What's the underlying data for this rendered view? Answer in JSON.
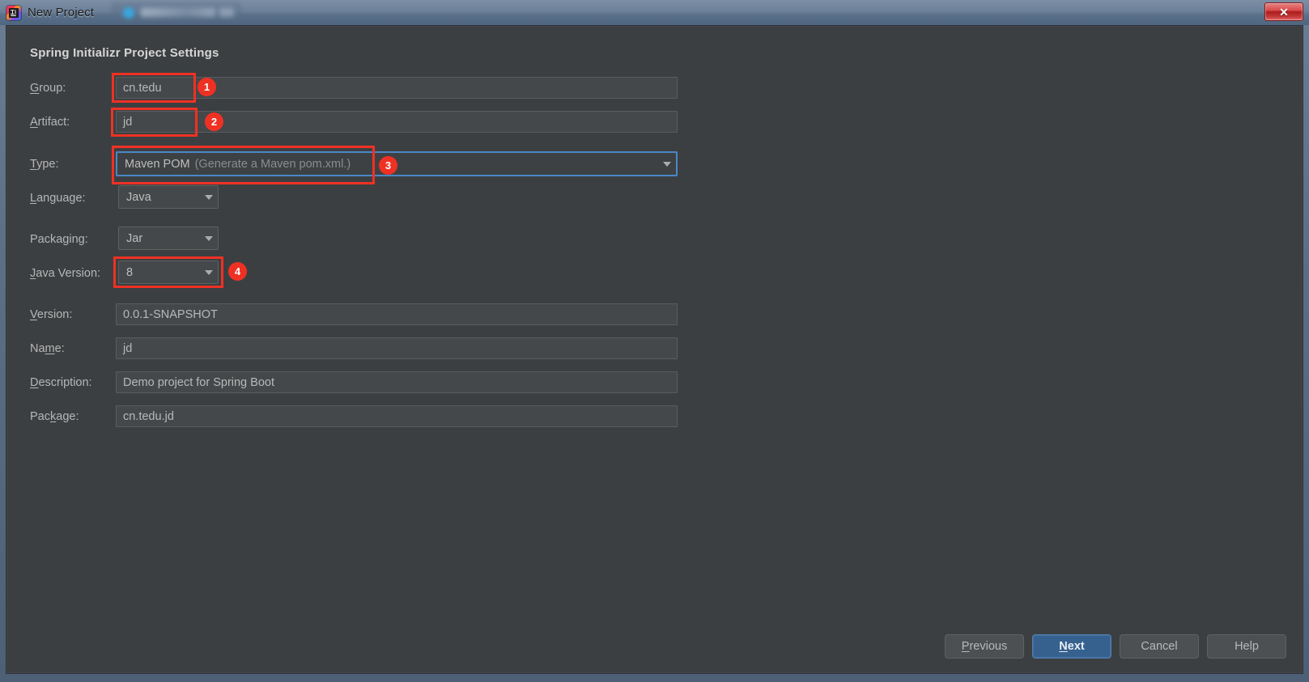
{
  "window": {
    "title": "New Project",
    "app_icon": "intellij-idea-icon",
    "close_label": "✕",
    "background_window_blurred": true
  },
  "dialog": {
    "section_title": "Spring Initializr Project Settings",
    "fields": [
      {
        "id": "group",
        "label": "Group:",
        "mnemonic": "G",
        "value": "cn.tedu",
        "control": "textfield"
      },
      {
        "id": "artifact",
        "label": "Artifact:",
        "mnemonic": "A",
        "value": "jd",
        "control": "textfield"
      },
      {
        "id": "type",
        "label": "Type:",
        "mnemonic": "T",
        "value": "Maven POM",
        "hint": "(Generate a Maven pom.xml.)",
        "control": "combobox",
        "focused": true
      },
      {
        "id": "language",
        "label": "Language:",
        "mnemonic": "L",
        "value": "Java",
        "control": "combobox"
      },
      {
        "id": "packaging",
        "label": "Packaging:",
        "mnemonic": "",
        "value": "Jar",
        "control": "combobox"
      },
      {
        "id": "javaversion",
        "label": "Java Version:",
        "mnemonic": "J",
        "value": "8",
        "control": "combobox"
      },
      {
        "id": "version",
        "label": "Version:",
        "mnemonic": "V",
        "value": "0.0.1-SNAPSHOT",
        "control": "textfield"
      },
      {
        "id": "name",
        "label": "Name:",
        "mnemonic": "m",
        "value": "jd",
        "control": "textfield"
      },
      {
        "id": "description",
        "label": "Description:",
        "mnemonic": "D",
        "value": "Demo project for Spring Boot",
        "control": "textfield"
      },
      {
        "id": "package",
        "label": "Package:",
        "mnemonic": "k",
        "value": "cn.tedu.jd",
        "control": "textfield"
      }
    ]
  },
  "annotations": [
    {
      "number": "1",
      "target": "group-field"
    },
    {
      "number": "2",
      "target": "artifact-field"
    },
    {
      "number": "3",
      "target": "type-combobox"
    },
    {
      "number": "4",
      "target": "java-version-combobox"
    }
  ],
  "footer": {
    "previous": "Previous",
    "next": "Next",
    "cancel": "Cancel",
    "help": "Help"
  },
  "colors": {
    "dialog_bg": "#3c3f41",
    "field_bg": "#45484a",
    "text": "#b6b6b6",
    "accent_blue": "#36618f",
    "focus_blue": "#4a88c7",
    "annotation_red": "#ef3124",
    "titlebar": "#6c8099",
    "close_red": "#ad1d1d"
  }
}
